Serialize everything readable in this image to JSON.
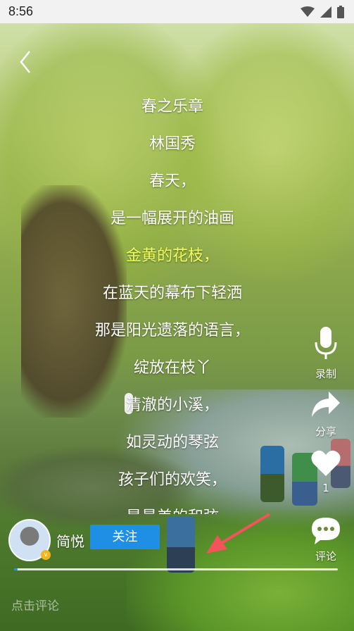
{
  "status_bar": {
    "time": "8:56"
  },
  "poem": {
    "lines": [
      "春之乐章",
      "林国秀",
      "春天，",
      "是一幅展开的油画",
      "金黄的花枝，",
      "在蓝天的幕布下轻洒",
      "那是阳光遗落的语言，",
      "绽放在枝丫",
      "清澈的小溪，",
      "如灵动的琴弦",
      "孩子们的欢笑，",
      "是最美的和弦"
    ],
    "active_index": 4,
    "active_color": "#f0ff5a"
  },
  "actions": {
    "record_label": "录制",
    "share_label": "分享",
    "like_count": "1",
    "comment_label": "评论"
  },
  "author": {
    "name": "简悦",
    "follow_label": "关注",
    "badge": "v"
  },
  "progress": {
    "value": 0.01
  },
  "comment_placeholder": "点击评论",
  "colors": {
    "accent": "#1f8fe6",
    "highlight": "#f0ff5a",
    "arrow": "#f2545b"
  }
}
